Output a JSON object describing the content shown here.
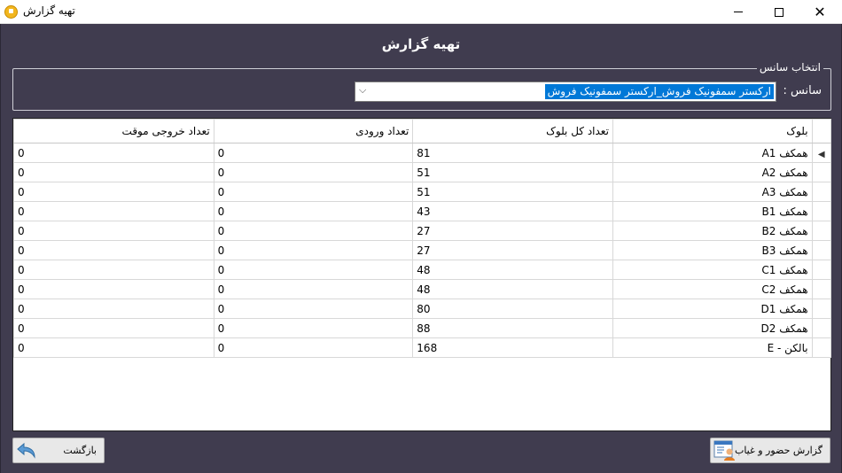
{
  "window": {
    "title": "تهیه گزارش",
    "close_glyph": "✕"
  },
  "header": {
    "title": "تهیه گزارش"
  },
  "session_group": {
    "legend": "انتخاب سانس",
    "label": "سانس :",
    "selected_value": "ارکستر سمفونیک فروش_ارکستر سمفونیک فروش",
    "chevron": "⌵"
  },
  "grid": {
    "columns": [
      "بلوک",
      "تعداد کل بلوک",
      "تعداد ورودی",
      "تعداد خروجی موقت"
    ],
    "current_row_marker": "◀",
    "rows": [
      {
        "block": "همکف  A1",
        "total": "81",
        "entered": "0",
        "temp_exit": "0"
      },
      {
        "block": "همکف A2",
        "total": "51",
        "entered": "0",
        "temp_exit": "0"
      },
      {
        "block": "همکف A3",
        "total": "51",
        "entered": "0",
        "temp_exit": "0"
      },
      {
        "block": "همکف B1",
        "total": "43",
        "entered": "0",
        "temp_exit": "0"
      },
      {
        "block": "همکف B2",
        "total": "27",
        "entered": "0",
        "temp_exit": "0"
      },
      {
        "block": "همکف B3",
        "total": "27",
        "entered": "0",
        "temp_exit": "0"
      },
      {
        "block": "همکف C1",
        "total": "48",
        "entered": "0",
        "temp_exit": "0"
      },
      {
        "block": "همکف C2",
        "total": "48",
        "entered": "0",
        "temp_exit": "0"
      },
      {
        "block": "همکف D1",
        "total": "80",
        "entered": "0",
        "temp_exit": "0"
      },
      {
        "block": "همکف D2",
        "total": "88",
        "entered": "0",
        "temp_exit": "0"
      },
      {
        "block": "بالکن - E",
        "total": "168",
        "entered": "0",
        "temp_exit": "0"
      }
    ]
  },
  "footer": {
    "back_label": "بازگشت",
    "back_icon": "back-arrow-icon",
    "report_label": "گزارش حضور و غیاب",
    "report_icon": "attendance-report-icon"
  },
  "colors": {
    "panel_bg": "#403c4f",
    "selection": "#0078d7",
    "app_icon": "#f2b61e"
  }
}
